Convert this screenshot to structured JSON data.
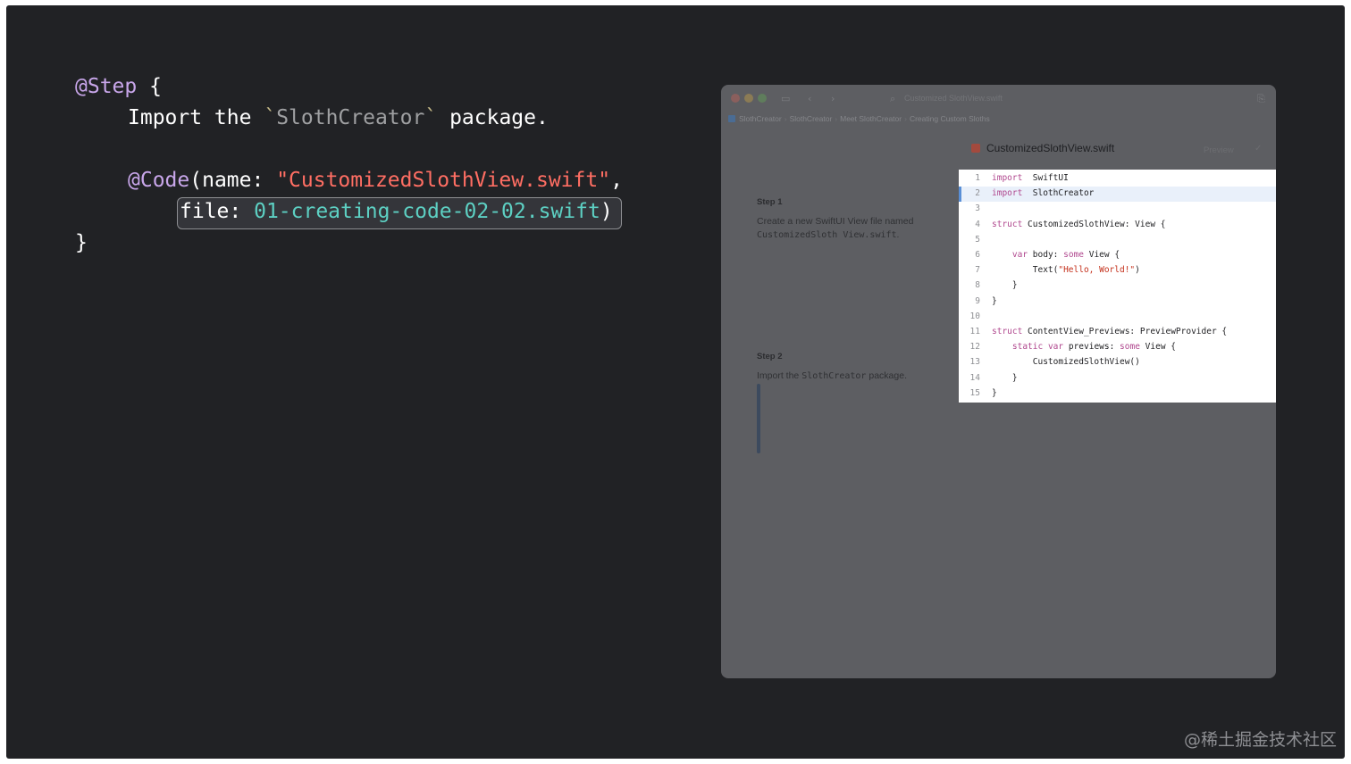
{
  "snippet": {
    "l1_directive": "@Step",
    "l1_brace": " {",
    "l2_pre": "Import the ",
    "l2_tick_open": "`",
    "l2_name": "SlothCreator",
    "l2_tick_close": "`",
    "l2_post": " package.",
    "l3_directive": "@Code",
    "l3_paren": "(name: ",
    "l3_string": "\"CustomizedSlothView.swift\"",
    "l3_comma": ",",
    "l4_label": "file: ",
    "l4_value": "01-creating-code-02-02.swift",
    "l4_close": ")",
    "l5_brace": "}"
  },
  "window": {
    "search_hint": "Customized SlothView.swift",
    "breadcrumbs": [
      "SlothCreator",
      "SlothCreator",
      "Meet SlothCreator",
      "Creating Custom Sloths"
    ],
    "steps": [
      {
        "title": "Step 1",
        "body_pre": "Create a new SwiftUI View file named ",
        "body_code": "CustomizedSloth View.swift",
        "body_post": "."
      },
      {
        "title": "Step 2",
        "body_pre": "Import the ",
        "body_code": "SlothCreator",
        "body_post": " package."
      }
    ],
    "file_tab": "CustomizedSlothView.swift",
    "preview_label": "Preview",
    "preview_check": "✓",
    "code_lines": [
      {
        "n": "1",
        "parts": [
          [
            "sk",
            "import"
          ],
          [
            "",
            "  SwiftUI"
          ]
        ]
      },
      {
        "n": "2",
        "parts": [
          [
            "sk",
            "import"
          ],
          [
            "",
            "  SlothCreator"
          ]
        ]
      },
      {
        "n": "3",
        "parts": []
      },
      {
        "n": "4",
        "parts": [
          [
            "sk",
            "struct"
          ],
          [
            "",
            " CustomizedSlothView: View {"
          ]
        ]
      },
      {
        "n": "5",
        "parts": []
      },
      {
        "n": "6",
        "parts": [
          [
            "",
            "    "
          ],
          [
            "sk",
            "var"
          ],
          [
            "",
            " body: "
          ],
          [
            "sk",
            "some"
          ],
          [
            "",
            " View {"
          ]
        ]
      },
      {
        "n": "7",
        "parts": [
          [
            "",
            "        Text("
          ],
          [
            "ss",
            "\"Hello, World!\""
          ],
          [
            "",
            ")"
          ]
        ]
      },
      {
        "n": "8",
        "parts": [
          [
            "",
            "    }"
          ]
        ]
      },
      {
        "n": "9",
        "parts": [
          [
            "",
            "}"
          ]
        ]
      },
      {
        "n": "10",
        "parts": []
      },
      {
        "n": "11",
        "parts": [
          [
            "sk",
            "struct"
          ],
          [
            "",
            " ContentView_Previews: PreviewProvider {"
          ]
        ]
      },
      {
        "n": "12",
        "parts": [
          [
            "",
            "    "
          ],
          [
            "sk",
            "static"
          ],
          [
            "",
            " "
          ],
          [
            "sk",
            "var"
          ],
          [
            "",
            " previews: "
          ],
          [
            "sk",
            "some"
          ],
          [
            "",
            " View {"
          ]
        ]
      },
      {
        "n": "13",
        "parts": [
          [
            "",
            "        CustomizedSlothView()"
          ]
        ]
      },
      {
        "n": "14",
        "parts": [
          [
            "",
            "    }"
          ]
        ]
      },
      {
        "n": "15",
        "parts": [
          [
            "",
            "}"
          ]
        ]
      }
    ],
    "highlighted_line": 2
  },
  "watermark": "@稀土掘金技术社区"
}
